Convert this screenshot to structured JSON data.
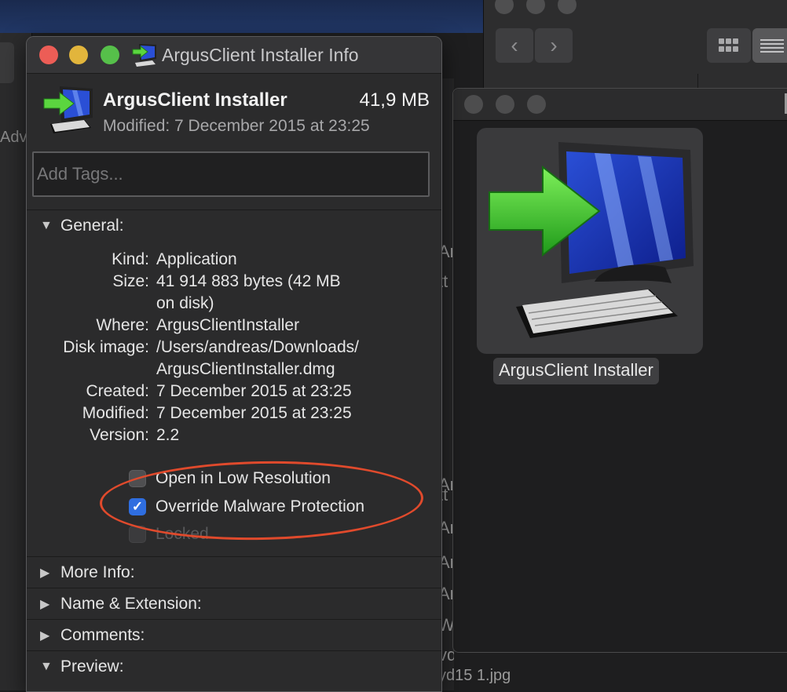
{
  "info_window": {
    "title": "ArgusClient Installer Info",
    "name": "ArgusClient Installer",
    "size": "41,9 MB",
    "modified_header": "Modified: 7 December 2015 at 23:25",
    "tags_placeholder": "Add Tags...",
    "sections": {
      "general": "General:",
      "more_info": "More Info:",
      "name_extension": "Name & Extension:",
      "comments": "Comments:",
      "preview": "Preview:"
    },
    "general": {
      "kind_label": "Kind:",
      "kind_value": "Application",
      "size_label": "Size:",
      "size_value_line1": "41 914 883 bytes (42 MB",
      "size_value_line2": "on disk)",
      "where_label": "Where:",
      "where_value": "ArgusClientInstaller",
      "disk_image_label": "Disk image:",
      "disk_image_line1": "/Users/andreas/Downloads/",
      "disk_image_line2": "ArgusClientInstaller.dmg",
      "created_label": "Created:",
      "created_value": "7 December 2015 at 23:25",
      "modified_label": "Modified:",
      "modified_value": "7 December 2015 at 23:25",
      "version_label": "Version:",
      "version_value": "2.2"
    },
    "options": {
      "low_resolution": {
        "label": "Open in Low Resolution",
        "checked": false
      },
      "override_malware": {
        "label": "Override Malware Protection",
        "checked": true
      },
      "locked": {
        "label": "Locked",
        "checked": false,
        "disabled": true
      }
    }
  },
  "right_window": {
    "file_caption": "ArgusClient Installer"
  },
  "background": {
    "left_tab_fragment": "Adv",
    "bottom_fragment": "yd15 1.jpg",
    "middle_fragments": [
      "Ar",
      "tt",
      "Ar",
      "tt",
      "Ar",
      "Ar",
      "Ar",
      "W",
      "vd"
    ]
  },
  "colors": {
    "traffic_close": "#ec5d56",
    "traffic_minimize": "#e2b53c",
    "traffic_zoom": "#56c04a",
    "checkbox_accent": "#2f6ee0",
    "annotation_ellipse": "#e04a2c"
  },
  "icons": {
    "app": "installer-monitor-arrow-icon",
    "back": "chevron-left-icon",
    "forward": "chevron-right-icon",
    "grid": "icon-grid-view-icon",
    "list": "list-view-icon",
    "disclosure_open": "triangle-down-icon",
    "disclosure_closed": "triangle-right-icon",
    "checkmark": "checkmark-icon"
  }
}
